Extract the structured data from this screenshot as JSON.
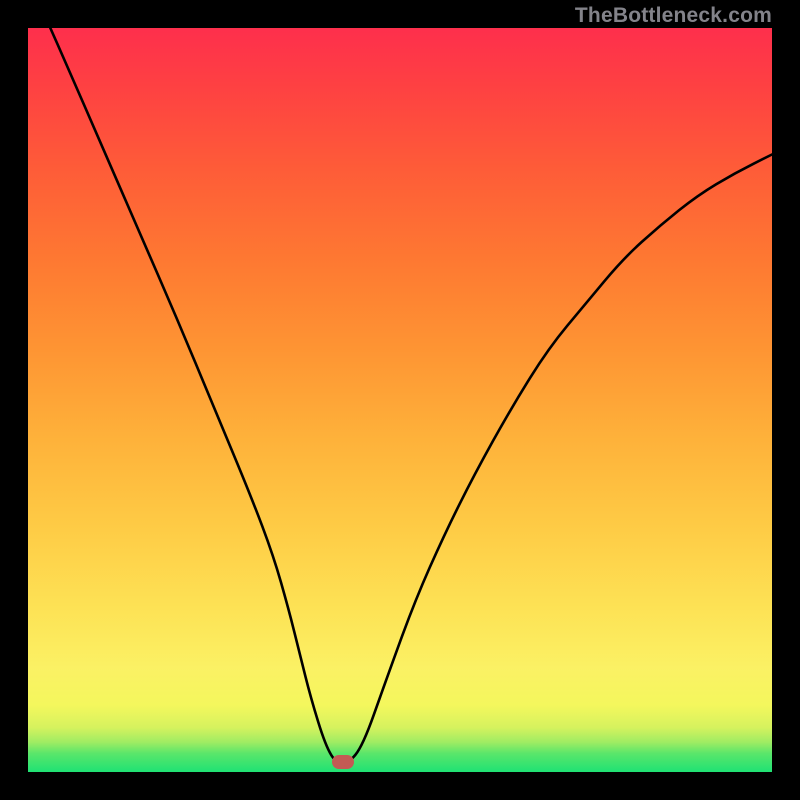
{
  "watermark": "TheBottleneck.com",
  "chart_data": {
    "type": "line",
    "title": "",
    "xlabel": "",
    "ylabel": "",
    "xlim": [
      0,
      100
    ],
    "ylim": [
      0,
      100
    ],
    "series": [
      {
        "name": "curve",
        "x": [
          3,
          5,
          10,
          15,
          20,
          25,
          30,
          33,
          35,
          36.5,
          38,
          40,
          41.5,
          43,
          45,
          48,
          52,
          56,
          60,
          65,
          70,
          75,
          80,
          85,
          90,
          95,
          100
        ],
        "values": [
          100,
          95.5,
          84,
          72.5,
          61,
          49,
          37,
          29,
          22,
          16,
          10,
          3.5,
          1.1,
          1.1,
          3.5,
          12,
          23,
          32,
          40,
          49,
          57,
          63,
          69,
          73.5,
          77.5,
          80.5,
          83
        ]
      }
    ],
    "marker": {
      "x": 42.3,
      "y": 1.3
    },
    "gradient_stops": [
      {
        "pct": 0,
        "color": "#1fe274"
      },
      {
        "pct": 2.5,
        "color": "#5ae66a"
      },
      {
        "pct": 4,
        "color": "#9fec63"
      },
      {
        "pct": 6,
        "color": "#d6f25e"
      },
      {
        "pct": 9,
        "color": "#f4f75d"
      },
      {
        "pct": 14,
        "color": "#fbf164"
      },
      {
        "pct": 22,
        "color": "#fde255"
      },
      {
        "pct": 33,
        "color": "#fecb45"
      },
      {
        "pct": 45,
        "color": "#feb13a"
      },
      {
        "pct": 57,
        "color": "#fe9433"
      },
      {
        "pct": 69,
        "color": "#fe7832"
      },
      {
        "pct": 81,
        "color": "#fe5c38"
      },
      {
        "pct": 92,
        "color": "#fe4142"
      },
      {
        "pct": 100,
        "color": "#fe2f4c"
      }
    ]
  }
}
